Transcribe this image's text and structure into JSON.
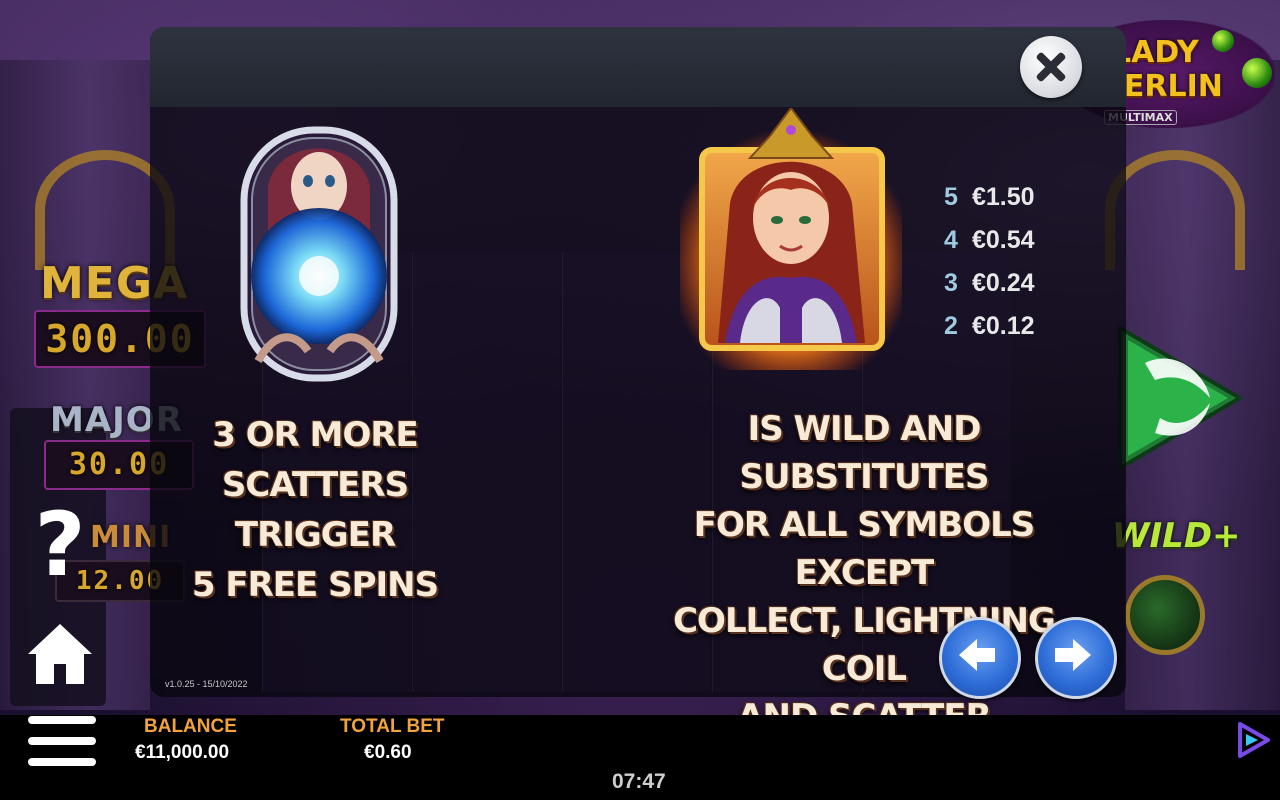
{
  "jackpots": {
    "mega": {
      "label": "MEGA",
      "value": "300.00"
    },
    "major": {
      "label": "MAJOR",
      "value": "30.00"
    },
    "mini": {
      "label": "MINI",
      "value": "12.00"
    }
  },
  "logo": {
    "line1": "LADY",
    "line2": "MERLIN",
    "sub": "MULTIMAX"
  },
  "side_badge": {
    "text": "WILD+"
  },
  "help": {
    "glyph": "?"
  },
  "paytable_page": {
    "scatter_description": [
      "3 OR MORE",
      "SCATTERS TRIGGER",
      "5 FREE SPINS"
    ],
    "wild_description": [
      "IS WILD AND SUBSTITUTES",
      "FOR ALL SYMBOLS EXCEPT",
      "COLLECT, LIGHTNING COIL",
      "AND SCATTER"
    ],
    "wild_pays": [
      {
        "count": "5",
        "amount": "€1.50"
      },
      {
        "count": "4",
        "amount": "€0.54"
      },
      {
        "count": "3",
        "amount": "€0.24"
      },
      {
        "count": "2",
        "amount": "€0.12"
      }
    ],
    "version": "v1.0.25 - 15/10/2022"
  },
  "footer": {
    "balance_label": "BALANCE",
    "balance_value": "€11,000.00",
    "total_bet_label": "TOTAL BET",
    "total_bet_value": "€0.60",
    "clock": "07:47"
  },
  "icons": {
    "close": "close-icon",
    "prev": "arrow-left-icon",
    "next": "arrow-right-icon",
    "menu": "hamburger-menu-icon",
    "home": "home-icon",
    "spin": "spin-play-icon"
  },
  "colors": {
    "accent_orange": "#f2a33a",
    "nav_blue": "#2f6ed8",
    "spin_green": "#2bb34a",
    "jackpot_gold": "#d6a72a"
  }
}
